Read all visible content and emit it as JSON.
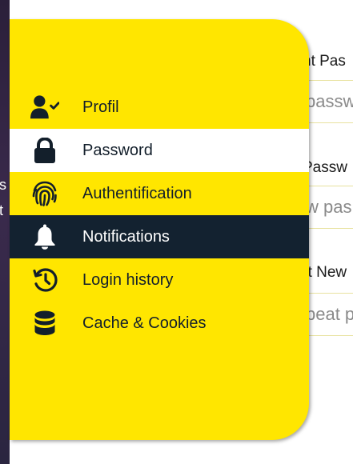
{
  "app": {
    "accent_color": "#ffe600",
    "active_color": "#132230",
    "hover_color": "#ffffff"
  },
  "background_app": {
    "left_fragments": [
      "s",
      "t"
    ],
    "labels": [
      "nt Pas",
      "Passw",
      "at New"
    ],
    "inputs": [
      {
        "value": "",
        "placeholder": "passw"
      },
      {
        "value": "",
        "placeholder": "w pas"
      },
      {
        "value": "",
        "placeholder": "peat p"
      }
    ]
  },
  "sidebar": {
    "items": [
      {
        "label": "Profil",
        "icon": "user-check-icon"
      },
      {
        "label": "Password",
        "icon": "lock-icon"
      },
      {
        "label": "Authentification",
        "icon": "fingerprint-icon"
      },
      {
        "label": "Notifications",
        "icon": "bell-icon"
      },
      {
        "label": "Login history",
        "icon": "history-icon"
      },
      {
        "label": "Cache & Cookies",
        "icon": "database-icon"
      }
    ],
    "hovered_index": 1,
    "active_index": 3
  }
}
